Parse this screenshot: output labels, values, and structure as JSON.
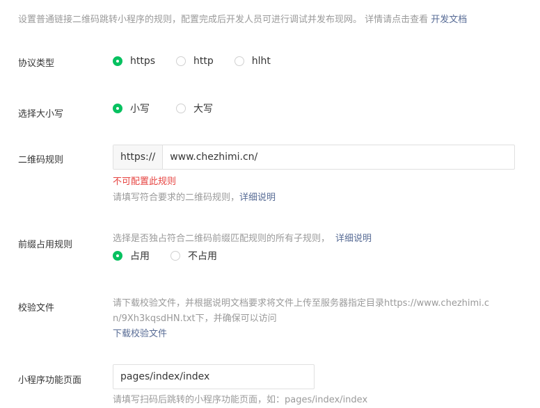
{
  "intro": {
    "text": "设置普通链接二维码跳转小程序的规则，配置完成后开发人员可进行调试并发布现网。 详情请点击查看 ",
    "link": "开发文档"
  },
  "protocol": {
    "label": "协议类型",
    "options": [
      "https",
      "http",
      "hlht"
    ],
    "selected": "https"
  },
  "case": {
    "label": "选择大小写",
    "options": [
      "小写",
      "大写"
    ],
    "selected": "小写"
  },
  "qr_rule": {
    "label": "二维码规则",
    "prefix": "https://",
    "value": "www.chezhimi.cn/",
    "error": "不可配置此规则",
    "hint": "请填写符合要求的二维码规则，",
    "hint_link": "详细说明"
  },
  "prefix_rule": {
    "label": "前缀占用规则",
    "desc": "选择是否独占符合二维码前缀匹配规则的所有子规则，",
    "desc_link": "详细说明",
    "options": [
      "占用",
      "不占用"
    ],
    "selected": "占用"
  },
  "verify_file": {
    "label": "校验文件",
    "desc_line1": "请下载校验文件，并根据说明文档要求将文件上传至服务器指定目录https://www.chezhimi.c",
    "desc_line2": "n/9Xh3kqsdHN.txt下，并确保可以访问",
    "download_link": "下载校验文件"
  },
  "page_path": {
    "label": "小程序功能页面",
    "value": "pages/index/index",
    "hint": "请填写扫码后跳转的小程序功能页面，如：pages/index/index"
  }
}
